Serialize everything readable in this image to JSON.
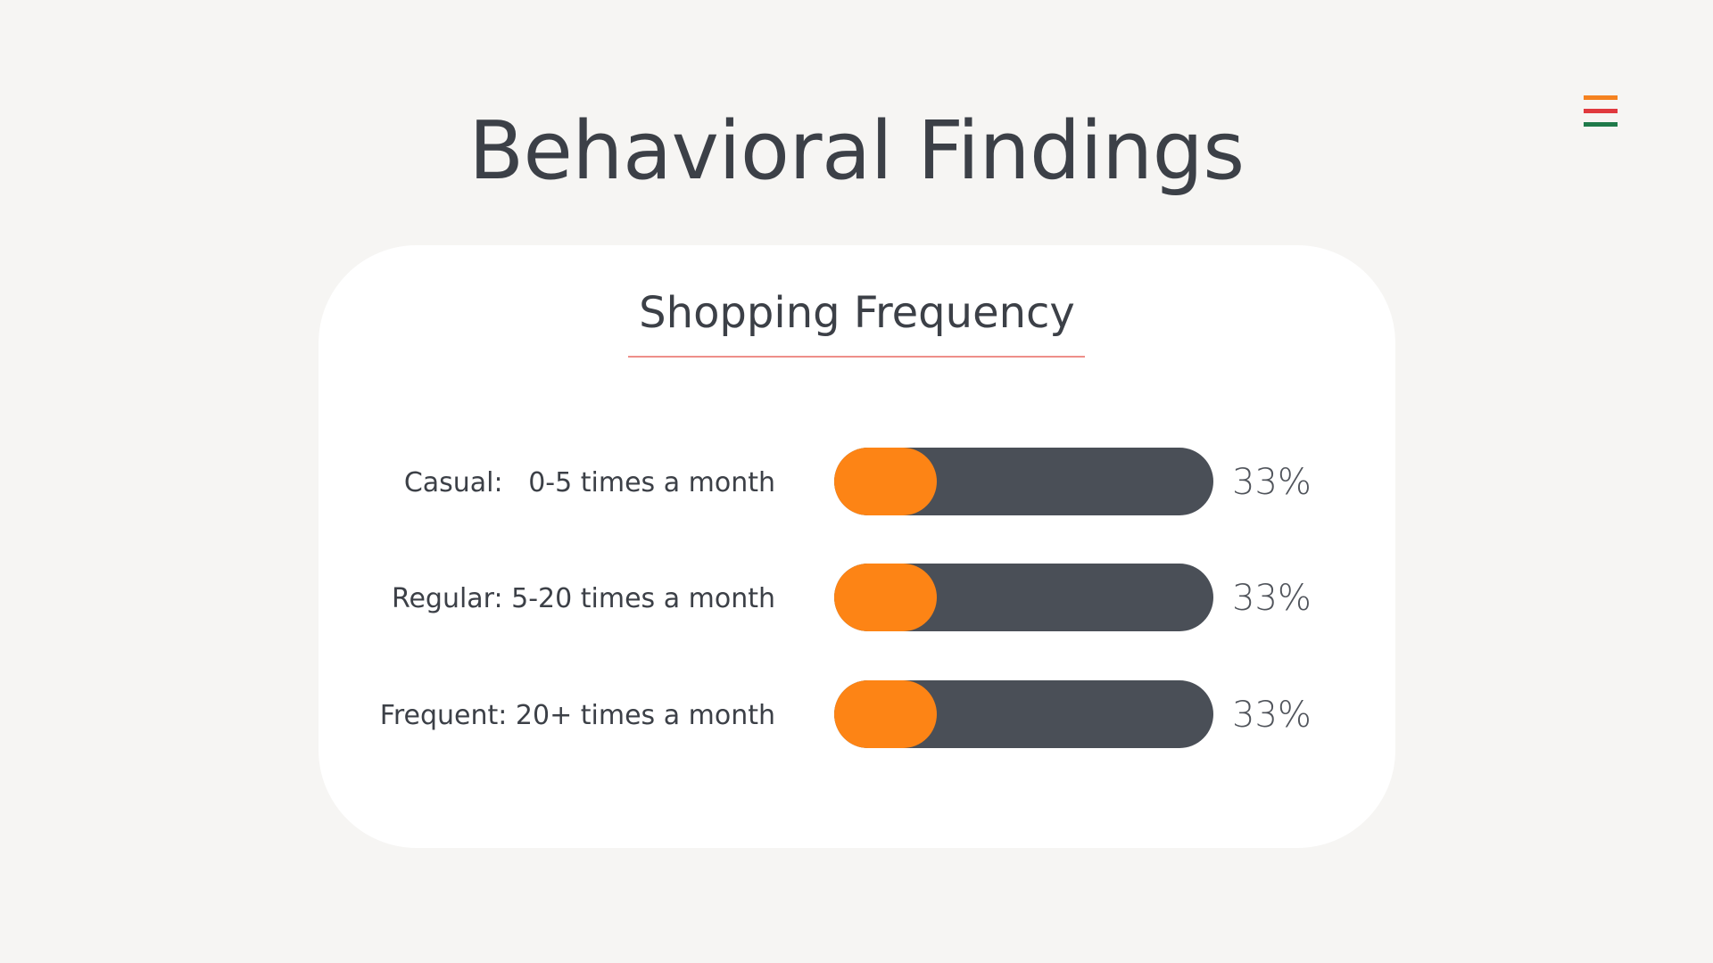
{
  "page": {
    "title": "Behavioral Findings"
  },
  "menu_icon": {
    "name": "menu-icon",
    "colors": [
      "#f58220",
      "#e0393e",
      "#1f7a4a"
    ]
  },
  "card": {
    "title": "Shopping Frequency",
    "underline_color": "#ee8f8a"
  },
  "colors": {
    "fill": "#fd8415",
    "track": "#4a4f57",
    "text": "#3c4047"
  },
  "chart_data": {
    "type": "bar",
    "orientation": "horizontal",
    "title": "Shopping Frequency",
    "categories": [
      "Casual:   0-5 times a month",
      "Regular: 5-20 times a month",
      "Frequent: 20+ times a month"
    ],
    "values": [
      33,
      33,
      33
    ],
    "value_labels": [
      "33%",
      "33%",
      "33%"
    ],
    "ylim": [
      0,
      100
    ],
    "grid": false
  }
}
